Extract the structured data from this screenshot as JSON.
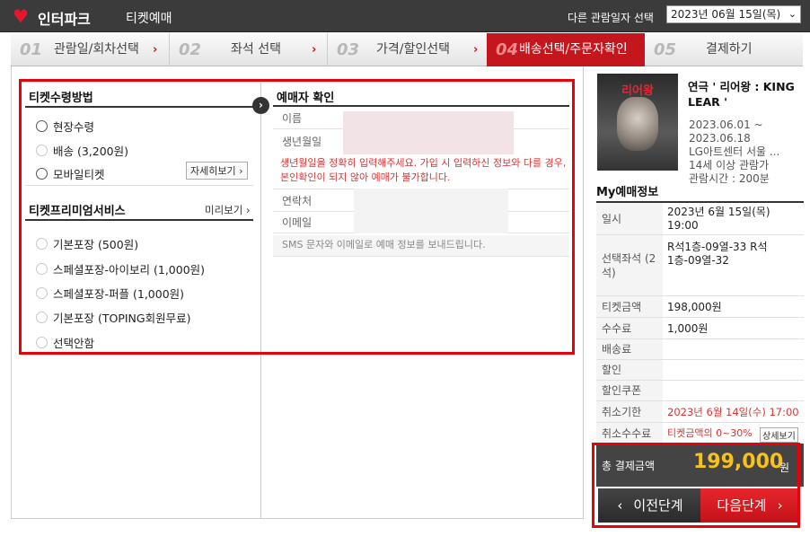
{
  "header": {
    "brand": "인터파크",
    "sub": "티켓예매",
    "date_label": "다른 관람일자 선택",
    "date_value": "2023년 06월 15일(목)"
  },
  "steps": [
    {
      "num": "01",
      "label": "관람일/회차선택"
    },
    {
      "num": "02",
      "label": "좌석 선택"
    },
    {
      "num": "03",
      "label": "가격/할인선택"
    },
    {
      "num": "04",
      "label": "배송선택/주문자확인"
    },
    {
      "num": "05",
      "label": "결제하기"
    }
  ],
  "delivery": {
    "title": "티켓수령방법",
    "options": [
      "현장수령",
      "배송 (3,200원)",
      "모바일티켓"
    ],
    "detail_btn": "자세히보기"
  },
  "premium": {
    "title": "티켓프리미엄서비스",
    "preview": "미리보기",
    "options": [
      "기본포장 (500원)",
      "스페셜포장-아이보리 (1,000원)",
      "스페셜포장-퍼플 (1,000원)",
      "기본포장 (TOPING회원무료)",
      "선택안함"
    ]
  },
  "booker": {
    "title": "예매자 확인",
    "name_label": "이름",
    "birth_label": "생년월일",
    "warning": "생년월일을 정확히 입력해주세요. 가입 시 입력하신 정보와 다를 경우, 본인확인이 되지 않아 예매가 불가합니다.",
    "phone_label": "연락처",
    "email_label": "이메일",
    "note": "SMS 문자와 이메일로 예매 정보를 보내드립니다."
  },
  "show": {
    "poster_title": "리어왕",
    "title": "연극 ' 리어왕 : KING LEAR '",
    "period": "2023.06.01 ~ 2023.06.18",
    "venue": "LG아트센터 서울 ...",
    "age": "14세 이상 관람가",
    "runtime": "관람시간 : 200분"
  },
  "my_info": {
    "title": "My예매정보",
    "rows": [
      {
        "k": "일시",
        "v": "2023년 6월 15일(목) 19:00"
      },
      {
        "k": "선택좌석 (2석)",
        "v": "R석1층-09열-33 R석1층-09열-32"
      },
      {
        "k": "티켓금액",
        "v": "198,000원"
      },
      {
        "k": "수수료",
        "v": "1,000원"
      },
      {
        "k": "배송료",
        "v": ""
      },
      {
        "k": "할인",
        "v": ""
      },
      {
        "k": "할인쿠폰",
        "v": ""
      },
      {
        "k": "취소기한",
        "v": "2023년 6월 14일(수) 17:00"
      },
      {
        "k": "취소수수료",
        "v": "티켓금액의 0~30%"
      }
    ],
    "detail_btn": "상세보기"
  },
  "total": {
    "label": "총 결제금액",
    "amount": "199,000",
    "unit": "원"
  },
  "buttons": {
    "prev": "이전단계",
    "next": "다음단계"
  },
  "colors": {
    "accent": "#c4161c",
    "highlight": "#e8000b",
    "total": "#f7c21b"
  }
}
